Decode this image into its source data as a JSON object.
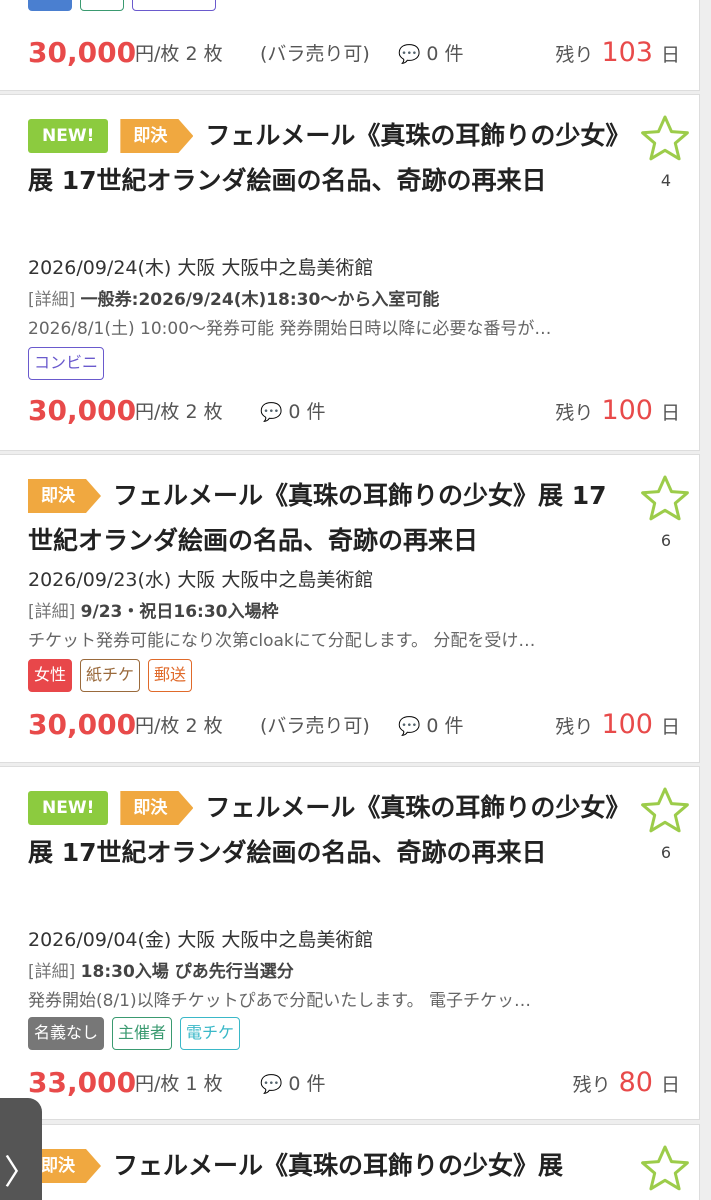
{
  "listings": [
    {
      "price": "30,000",
      "unit": "円/枚",
      "quantity": "2 枚",
      "split": "(バラ売り可)",
      "comments": "0 件",
      "remain_label": "残り",
      "remain_days": "103",
      "remain_unit": "日"
    },
    {
      "badges": [
        "NEW!",
        "即決"
      ],
      "title": "フェルメール《真珠の耳飾りの少女》展 17世紀オランダ絵画の名品、奇跡の再来日",
      "favorites": "4",
      "date": "2026/09/24(木) 大阪 大阪中之島美術館",
      "detail_label": "[詳細]",
      "detail": "一般券:2026/9/24(木)18:30〜から入室可能",
      "note": "2026/8/1(土) 10:00〜発券可能 発券開始日時以降に必要な番号が…",
      "tags": [
        "コンビニ"
      ],
      "price": "30,000",
      "unit": "円/枚",
      "quantity": "2 枚",
      "comments": "0 件",
      "remain_label": "残り",
      "remain_days": "100",
      "remain_unit": "日"
    },
    {
      "badges": [
        "即決"
      ],
      "title": "フェルメール《真珠の耳飾りの少女》展 17世紀オランダ絵画の名品、奇跡の再来日",
      "favorites": "6",
      "date": "2026/09/23(水) 大阪 大阪中之島美術館",
      "detail_label": "[詳細]",
      "detail": "9/23・祝日16:30入場枠",
      "note": "チケット発券可能になり次第cloakにて分配します。 分配を受け…",
      "tags": [
        "女性",
        "紙チケ",
        "郵送"
      ],
      "price": "30,000",
      "unit": "円/枚",
      "quantity": "2 枚",
      "split": "(バラ売り可)",
      "comments": "0 件",
      "remain_label": "残り",
      "remain_days": "100",
      "remain_unit": "日"
    },
    {
      "badges": [
        "NEW!",
        "即決"
      ],
      "title": "フェルメール《真珠の耳飾りの少女》展 17世紀オランダ絵画の名品、奇跡の再来日",
      "favorites": "6",
      "date": "2026/09/04(金) 大阪 大阪中之島美術館",
      "detail_label": "[詳細]",
      "detail": "18:30入場 ぴあ先行当選分",
      "note": "発券開始(8/1)以降チケットぴあで分配いたします。 電子チケッ…",
      "tags": [
        "名義なし",
        "主催者",
        "電チケ"
      ],
      "price": "33,000",
      "unit": "円/枚",
      "quantity": "1 枚",
      "comments": "0 件",
      "remain_label": "残り",
      "remain_days": "80",
      "remain_unit": "日"
    },
    {
      "badges": [
        "即決"
      ],
      "title": "フェルメール《真珠の耳飾りの少女》展"
    }
  ],
  "nav_arrow": "〉",
  "colors": {
    "price": "#e84a4a",
    "new_badge": "#8ccb3f",
    "quick_badge": "#f0a840",
    "star": "#9ccc4a"
  },
  "icons": [
    "star-icon",
    "comment-bubble-icon",
    "chevron-right-icon"
  ]
}
